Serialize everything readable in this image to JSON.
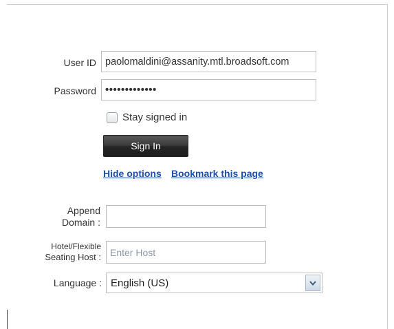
{
  "form": {
    "user_id_label": "User ID",
    "user_id_value": "paolomaldini@assanity.mtl.broadsoft.com",
    "password_label": "Password",
    "password_value": "•••••••••••••",
    "stay_signed_in_label": "Stay signed in",
    "stay_signed_in_checked": false,
    "sign_in_label": "Sign In"
  },
  "links": {
    "hide_options": "Hide options",
    "bookmark": "Bookmark this page"
  },
  "options": {
    "append_domain_label_line1": "Append",
    "append_domain_label_line2": "Domain :",
    "append_domain_value": "",
    "host_label_line1": "Hotel/Flexible",
    "host_label_line2": "Seating Host :",
    "host_placeholder": "Enter Host",
    "language_label": "Language :",
    "language_value": "English (US)"
  },
  "icons": {
    "dropdown_arrow": "chevron-down-icon"
  }
}
